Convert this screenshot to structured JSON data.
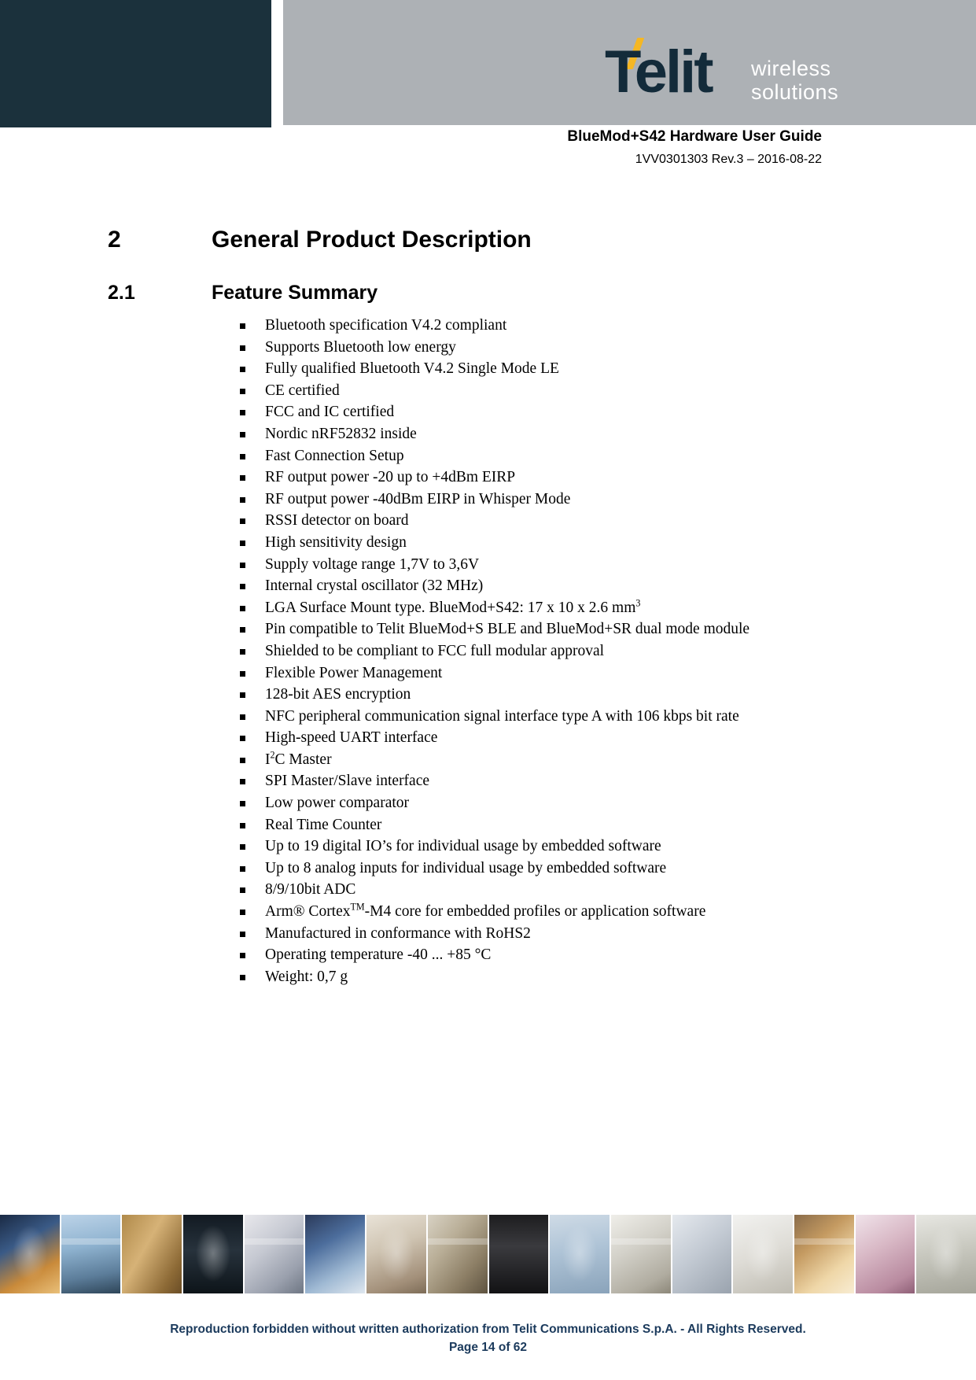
{
  "header": {
    "logo": {
      "brand": "Telit",
      "tagline_line1": "wireless",
      "tagline_line2": "solutions",
      "dark_color": "#132b3a",
      "accent_color": "#f5b723",
      "band_color": "#adb1b5",
      "block_color": "#1b313c"
    },
    "document_title": "BlueMod+S42 Hardware User Guide",
    "document_ref": "1VV0301303 Rev.3 – 2016-08-22"
  },
  "sections": {
    "chapter": {
      "number": "2",
      "title": "General Product Description"
    },
    "subsection": {
      "number": "2.1",
      "title": "Feature Summary"
    }
  },
  "features": [
    {
      "text": "Bluetooth specification V4.2 compliant"
    },
    {
      "text": "Supports Bluetooth low energy"
    },
    {
      "text": "Fully qualified Bluetooth V4.2 Single Mode LE"
    },
    {
      "text": "CE certified"
    },
    {
      "text": "FCC and IC certified"
    },
    {
      "text": "Nordic nRF52832 inside"
    },
    {
      "text": "Fast Connection Setup"
    },
    {
      "text": "RF output power -20 up to +4dBm EIRP"
    },
    {
      "text": "RF output power -40dBm EIRP in Whisper Mode"
    },
    {
      "text": "RSSI detector on board"
    },
    {
      "text": "High sensitivity design"
    },
    {
      "text": "Supply voltage range 1,7V to 3,6V"
    },
    {
      "text": "Internal crystal oscillator (32 MHz)"
    },
    {
      "text": "LGA Surface Mount type. BlueMod+S42: 17 x 10 x 2.6 mm",
      "sup": "3"
    },
    {
      "text": "Pin compatible to Telit BlueMod+S BLE and BlueMod+SR dual mode module"
    },
    {
      "text": "Shielded to be compliant to FCC full modular approval"
    },
    {
      "text": "Flexible Power Management"
    },
    {
      "text": "128-bit AES encryption"
    },
    {
      "text": "NFC peripheral communication signal interface type A with 106 kbps bit rate"
    },
    {
      "text": "High-speed UART interface"
    },
    {
      "text": "I",
      "sup": "2",
      "text_after": "C Master"
    },
    {
      "text": "SPI Master/Slave interface"
    },
    {
      "text": "Low power comparator"
    },
    {
      "text": "Real Time Counter"
    },
    {
      "text": "Up to 19 digital IO’s for individual usage by embedded software"
    },
    {
      "text": "Up to 8 analog inputs for individual usage by embedded software"
    },
    {
      "text": "8/9/10bit ADC"
    },
    {
      "text": "Arm® Cortex",
      "sup": "TM",
      "text_after": "-M4 core for embedded profiles or application software"
    },
    {
      "text": "Manufactured in conformance with RoHS2"
    },
    {
      "text": "Operating temperature -40 ... +85 °C"
    },
    {
      "text": "Weight: 0,7 g"
    }
  ],
  "footer": {
    "copyright": "Reproduction forbidden without written authorization from Telit Communications S.p.A. - All Rights Reserved.",
    "page": "Page 14 of 62",
    "text_color": "#1b3a5c",
    "photo_strip": [
      "bridge-sunset-photo",
      "signpost-phone-photo",
      "shipping-containers-photo",
      "digital-clock-photo",
      "keyboard-photo",
      "cyclist-photo",
      "document-printer-photo",
      "warehouse-shelves-photo",
      "electric-meter-photo",
      "wind-turbine-photo",
      "kilowatt-gauge-photo",
      "architecture-photo",
      "escalator-photo",
      "industrial-worker-photo",
      "pink-cylinders-photo",
      "security-camera-photo"
    ]
  }
}
